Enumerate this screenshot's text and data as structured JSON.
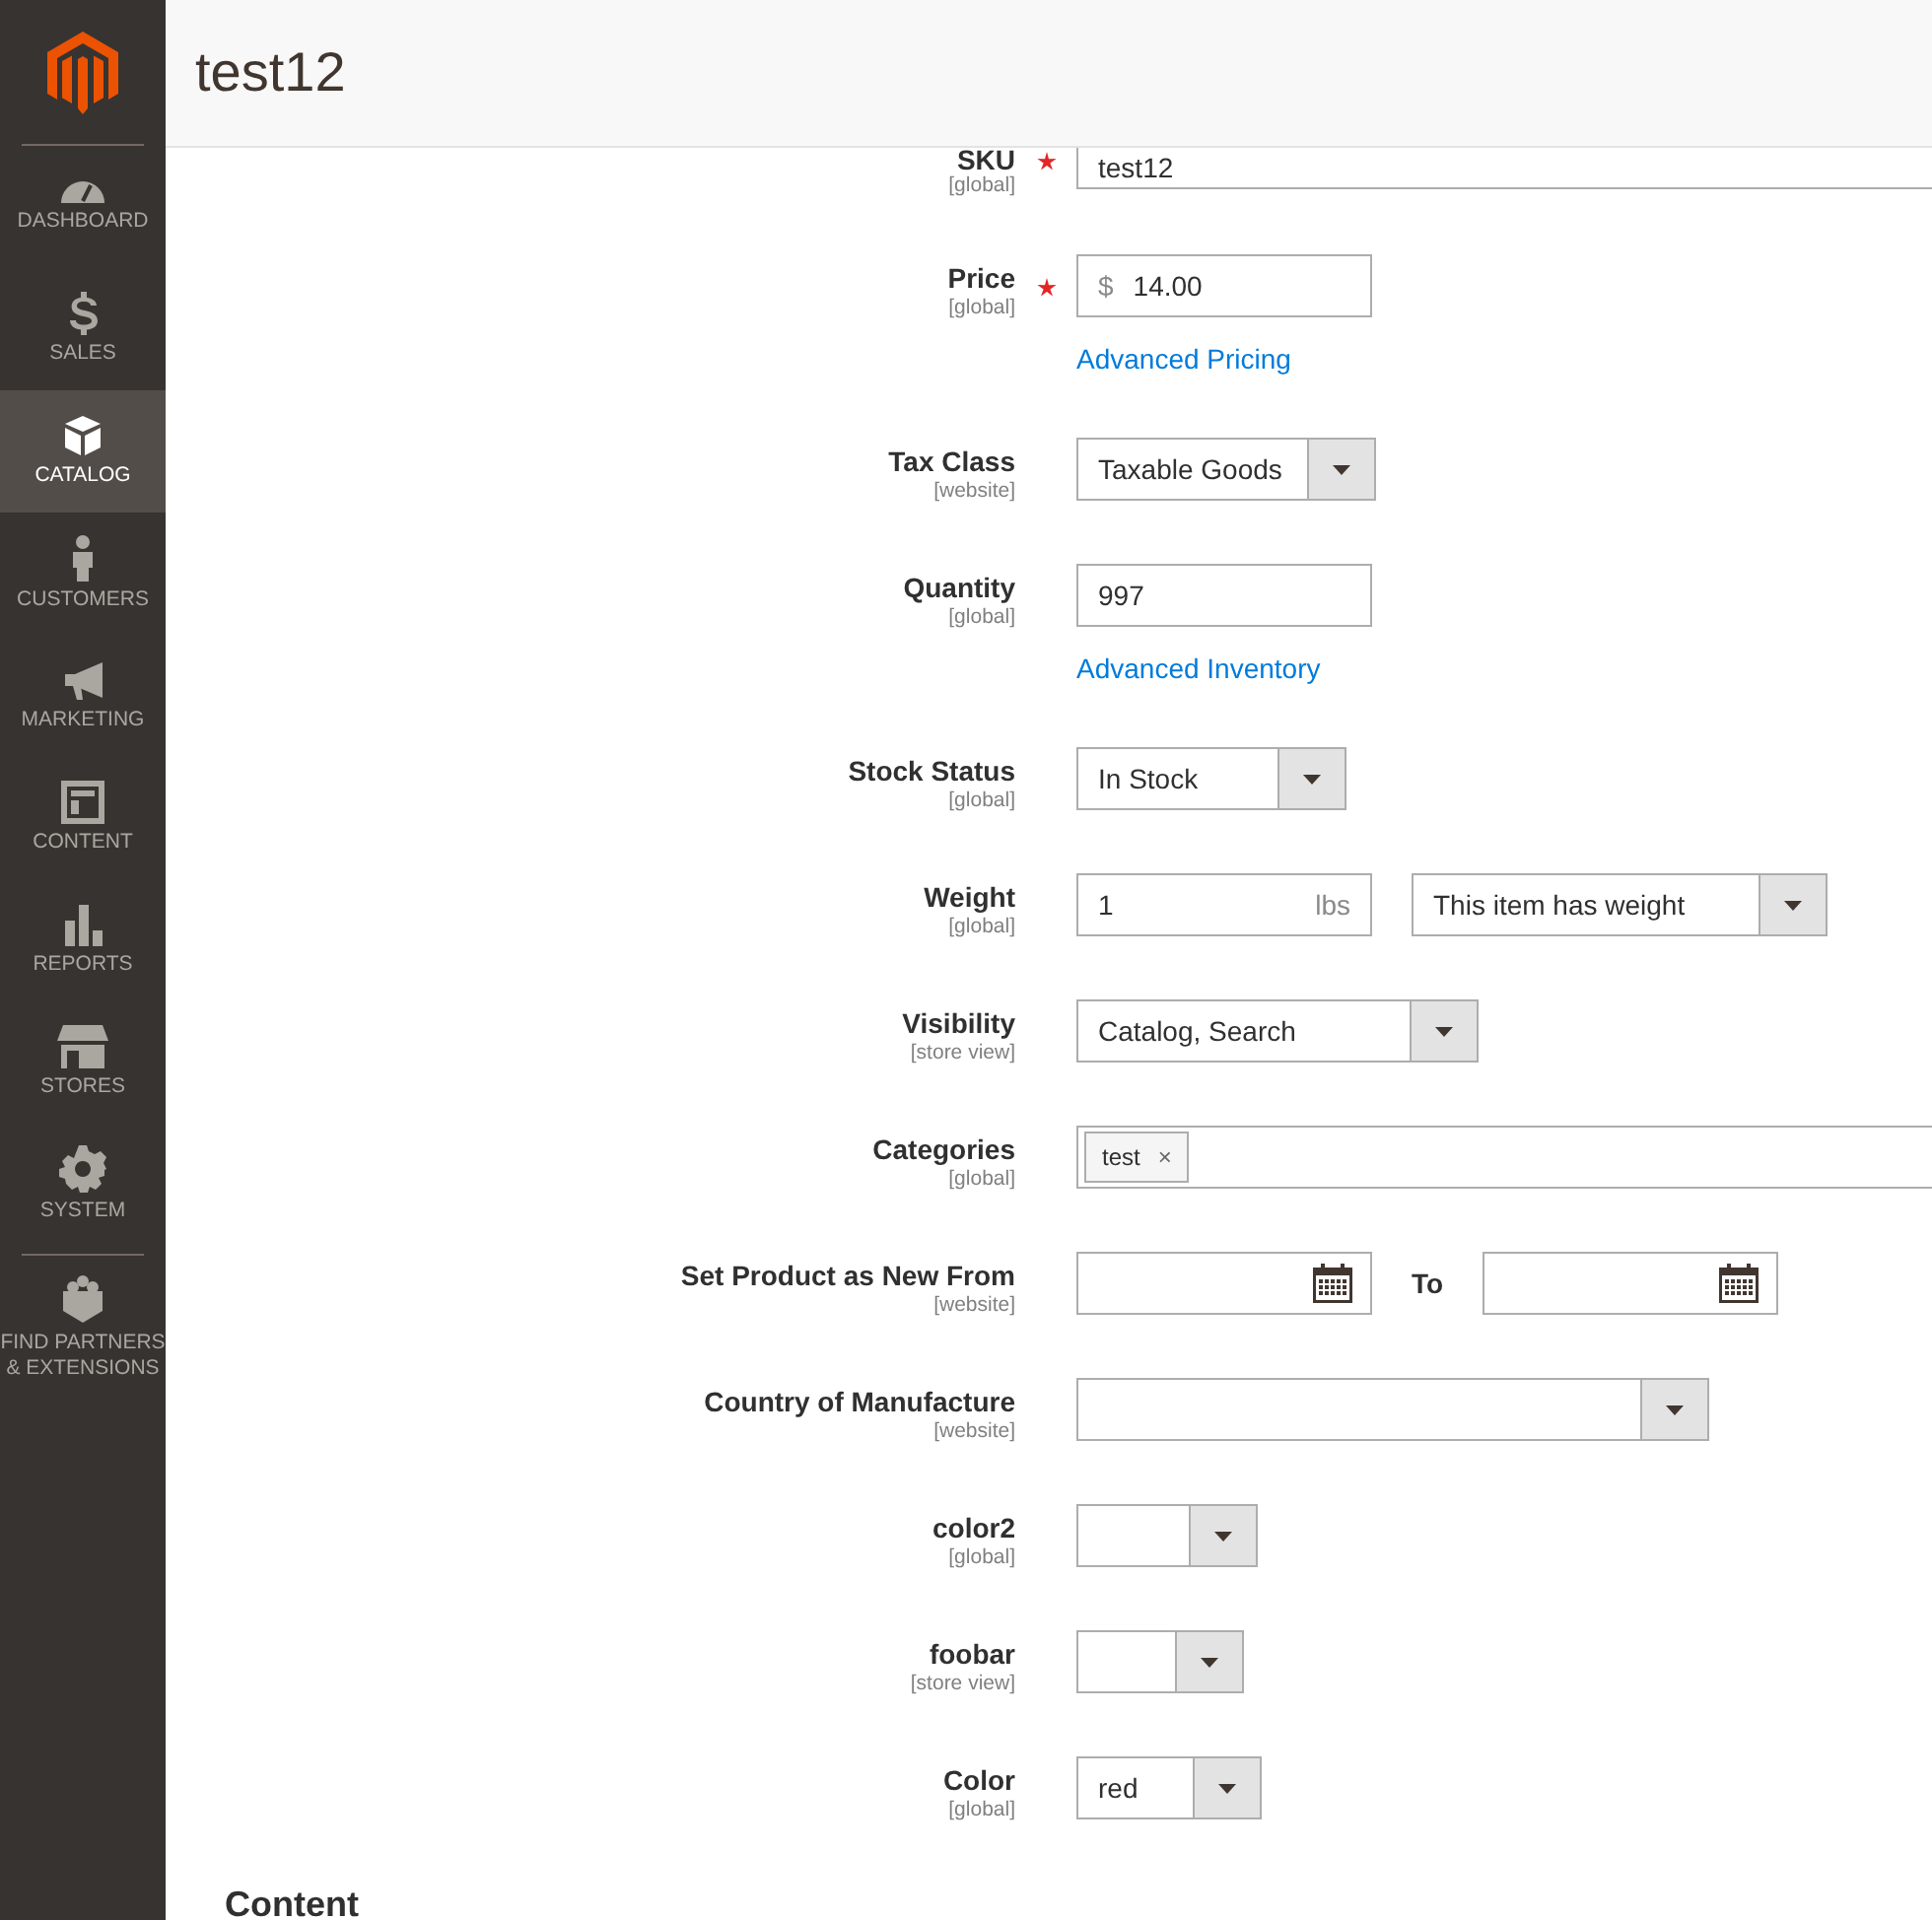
{
  "header": {
    "title": "test12"
  },
  "sidebar": {
    "items": [
      {
        "label": "DASHBOARD",
        "selected": false
      },
      {
        "label": "SALES",
        "selected": false
      },
      {
        "label": "CATALOG",
        "selected": true
      },
      {
        "label": "CUSTOMERS",
        "selected": false
      },
      {
        "label": "MARKETING",
        "selected": false
      },
      {
        "label": "CONTENT",
        "selected": false
      },
      {
        "label": "REPORTS",
        "selected": false
      },
      {
        "label": "STORES",
        "selected": false
      },
      {
        "label": "SYSTEM",
        "selected": false
      },
      {
        "label": "FIND PARTNERS & EXTENSIONS",
        "selected": false
      }
    ]
  },
  "fields": [
    {
      "label": "SKU",
      "scope": "[global]",
      "required": true,
      "kind": "wide_text",
      "value": "test12"
    },
    {
      "label": "Price",
      "scope": "[global]",
      "required": true,
      "kind": "text",
      "prefix": "$",
      "value": "14.00",
      "link": "Advanced Pricing"
    },
    {
      "label": "Tax Class",
      "scope": "[website]",
      "required": false,
      "kind": "select",
      "value": "Taxable Goods"
    },
    {
      "label": "Quantity",
      "scope": "[global]",
      "required": false,
      "kind": "text",
      "value": "997",
      "link": "Advanced Inventory"
    },
    {
      "label": "Stock Status",
      "scope": "[global]",
      "required": false,
      "kind": "select",
      "value": "In Stock"
    },
    {
      "label": "Weight",
      "scope": "[global]",
      "required": false,
      "kind": "weight",
      "value": "1",
      "suffix": "lbs",
      "option": "This item has weight"
    },
    {
      "label": "Visibility",
      "scope": "[store view]",
      "required": false,
      "kind": "select",
      "value": "Catalog, Search"
    },
    {
      "label": "Categories",
      "scope": "[global]",
      "required": false,
      "kind": "tags",
      "tags": [
        {
          "label": "test",
          "remove": "×"
        }
      ]
    },
    {
      "label": "Set Product as New From",
      "scope": "[website]",
      "required": false,
      "kind": "date_range",
      "to_label": "To"
    },
    {
      "label": "Country of Manufacture",
      "scope": "[website]",
      "required": false,
      "kind": "select"
    },
    {
      "label": "color2",
      "scope": "[global]",
      "required": false,
      "kind": "select"
    },
    {
      "label": "foobar",
      "scope": "[store view]",
      "required": false,
      "kind": "select"
    },
    {
      "label": "Color",
      "scope": "[global]",
      "required": false,
      "kind": "select",
      "value": "red"
    }
  ],
  "section": {
    "title": "Content"
  }
}
